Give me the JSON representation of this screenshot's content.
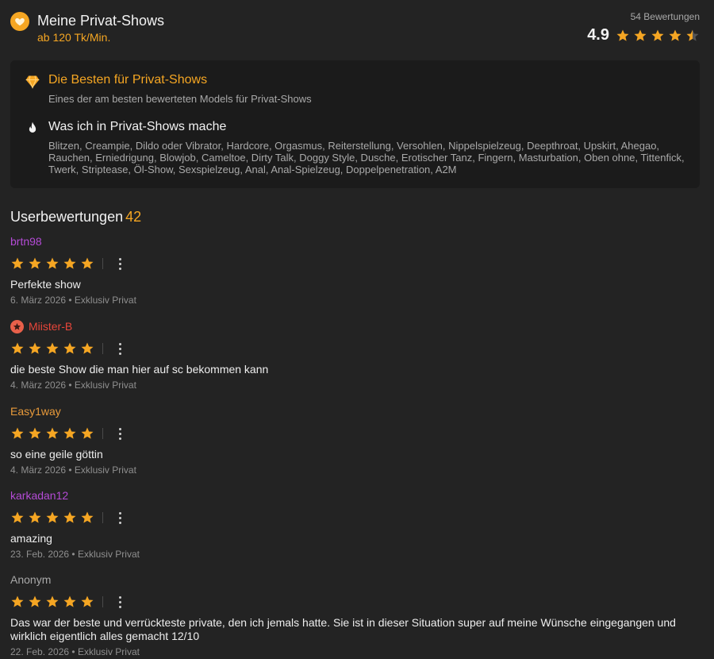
{
  "header": {
    "title": "Meine Privat-Shows",
    "price": "ab 120 Tk/Min.",
    "review_count": "54 Bewertungen",
    "rating": "4.9",
    "rating_value": 4.9,
    "icon": "heart-icon"
  },
  "panel": {
    "best": {
      "icon": "diamond-icon",
      "heading": "Die Besten für Privat-Shows",
      "text": "Eines der am besten bewerteten Models für Privat-Shows"
    },
    "activities": {
      "icon": "flame-icon",
      "heading": "Was ich in Privat-Shows mache",
      "text": "Blitzen, Creampie, Dildo oder Vibrator, Hardcore, Orgasmus, Reiterstellung, Versohlen, Nippelspielzeug, Deepthroat, Upskirt, Ahegao, Rauchen, Erniedrigung, Blowjob, Cameltoe, Dirty Talk, Doggy Style, Dusche, Erotischer Tanz, Fingern, Masturbation, Oben ohne, Tittenfick, Twerk, Striptease, Öl-Show, Sexspielzeug, Anal, Anal-Spielzeug, Doppelpenetration, A2M"
    }
  },
  "reviews": {
    "title": "Userbewertungen",
    "count": "42",
    "items": [
      {
        "user": "brtn98",
        "color": "#b44bd6",
        "badge": false,
        "stars": 5,
        "text": "Perfekte show",
        "date": "6. März 2026",
        "type": "Exklusiv Privat"
      },
      {
        "user": "Miister-B",
        "color": "#e8463a",
        "badge": true,
        "stars": 5,
        "text": "die beste Show die man hier auf sc bekommen kann",
        "date": "4. März 2026",
        "type": "Exklusiv Privat"
      },
      {
        "user": "Easy1way",
        "color": "#e89a3a",
        "badge": false,
        "stars": 5,
        "text": "so eine geile göttin",
        "date": "4. März 2026",
        "type": "Exklusiv Privat"
      },
      {
        "user": "karkadan12",
        "color": "#b44bd6",
        "badge": false,
        "stars": 5,
        "text": "amazing",
        "date": "23. Feb. 2026",
        "type": "Exklusiv Privat"
      },
      {
        "user": "Anonym",
        "color": "#a8a8a8",
        "badge": false,
        "stars": 5,
        "text": "Das war der beste und verrückteste private, den ich jemals hatte. Sie ist in dieser Situation super auf meine Wünsche eingegangen und wirklich eigentlich alles gemacht 12/10",
        "date": "22. Feb. 2026",
        "type": "Exklusiv Privat"
      }
    ]
  },
  "colors": {
    "accent": "#f5a623",
    "star": "#f5a623",
    "background": "#232323",
    "panel": "#1b1b1b"
  }
}
